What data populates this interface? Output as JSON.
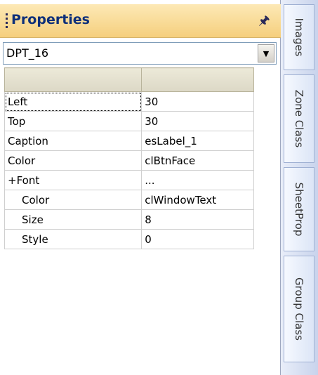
{
  "panel": {
    "title": "Properties",
    "pin_icon": "pin-icon",
    "object_select": {
      "value": "DPT_16",
      "arrow_icon": "dropdown-arrow-icon"
    }
  },
  "grid": {
    "rows": [
      {
        "name": "Left",
        "value": "30"
      },
      {
        "name": "Top",
        "value": "30"
      },
      {
        "name": "Caption",
        "value": "esLabel_1"
      },
      {
        "name": "Color",
        "value": "clBtnFace"
      },
      {
        "name": "+Font",
        "value": "..."
      },
      {
        "name": "Color",
        "value": "clWindowText"
      },
      {
        "name": "Size",
        "value": "8"
      },
      {
        "name": "Style",
        "value": "0"
      }
    ]
  },
  "side_tabs": [
    "Images",
    "Zone Class",
    "SheetProp",
    "Group Class"
  ],
  "colors": {
    "header_top": "#fde9b6",
    "header_bottom": "#f5cf7d",
    "title_text": "#0d2f7a",
    "rail": "#c8d3ec"
  }
}
